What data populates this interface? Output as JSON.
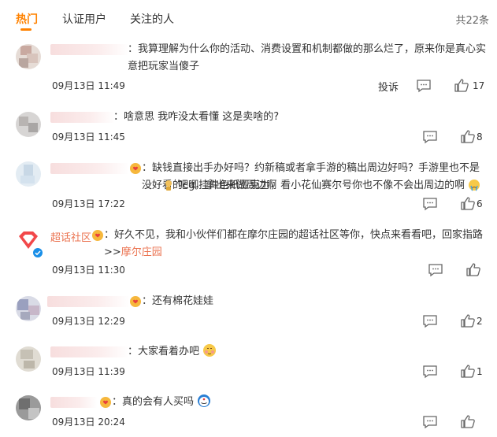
{
  "tabs": [
    {
      "label": "热门"
    },
    {
      "label": "认证用户"
    },
    {
      "label": "关注的人"
    }
  ],
  "total_label": "共22条",
  "comments": [
    {
      "text": "：我算理解为什么你的活动、消费设置和机制都做的那么烂了，原来你是真心实意把玩家当傻子",
      "time": "09月13日 11:49",
      "report": "投诉",
      "likes": "17"
    },
    {
      "text": "：啥意思 我咋没太看懂 这是卖啥的?",
      "time": "09月13日 11:45",
      "likes": "8"
    },
    {
      "text_a": "：缺钱直接出手办好吗？约新稿或者拿手游的稿出周边好吗？手游里也不是没好看的cg，拿出来做周边啊",
      "text_b": "吧唧挂件色纸亚克力，看小花仙赛尔号你也不像不会出周边的啊",
      "time": "09月13日 17:22",
      "likes": "6"
    },
    {
      "author": "超话社区",
      "text": "：好久不见，我和小伙伴们都在摩尔庄园的超话社区等你，快点来看看吧，回家指路>>",
      "mention": "摩尔庄园",
      "time": "09月13日 11:30",
      "likes": ""
    },
    {
      "text": "：还有棉花娃娃",
      "time": "09月13日 12:29",
      "likes": "2"
    },
    {
      "text": "：大家看着办吧",
      "time": "09月13日 11:39",
      "likes": "1"
    },
    {
      "text": "：真的会有人买吗",
      "time": "09月13日 20:24",
      "likes": ""
    }
  ]
}
